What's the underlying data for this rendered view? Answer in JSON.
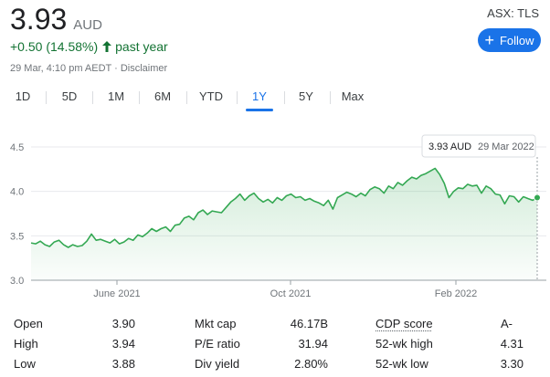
{
  "quote": {
    "price": "3.93",
    "currency": "AUD",
    "change": "+0.50 (14.58%)",
    "period": "past year",
    "timestamp": "29 Mar, 4:10 pm AEDT · Disclaimer",
    "ticker": "ASX: TLS",
    "follow_label": "Follow",
    "colors": {
      "positive": "#137333",
      "accent": "#1a73e8",
      "line": "#34a853"
    }
  },
  "range_tabs": [
    {
      "label": "1D",
      "active": false
    },
    {
      "label": "5D",
      "active": false
    },
    {
      "label": "1M",
      "active": false
    },
    {
      "label": "6M",
      "active": false
    },
    {
      "label": "YTD",
      "active": false
    },
    {
      "label": "1Y",
      "active": true
    },
    {
      "label": "5Y",
      "active": false
    },
    {
      "label": "Max",
      "active": false
    }
  ],
  "tooltip": {
    "price": "3.93 AUD",
    "date": "29 Mar 2022"
  },
  "chart_data": {
    "type": "area",
    "title": "",
    "xlabel": "",
    "ylabel": "",
    "ylim": [
      3.0,
      4.5
    ],
    "yticks": [
      "4.5",
      "4.0",
      "3.5",
      "3.0"
    ],
    "xticks": [
      "June 2021",
      "Oct 2021",
      "Feb 2022"
    ],
    "grid": true,
    "legend": "none",
    "series": [
      {
        "values": [
          3.42,
          3.41,
          3.44,
          3.4,
          3.38,
          3.43,
          3.45,
          3.4,
          3.37,
          3.4,
          3.38,
          3.39,
          3.44,
          3.52,
          3.45,
          3.46,
          3.44,
          3.42,
          3.46,
          3.41,
          3.43,
          3.47,
          3.45,
          3.51,
          3.49,
          3.53,
          3.58,
          3.55,
          3.58,
          3.6,
          3.55,
          3.62,
          3.63,
          3.7,
          3.72,
          3.68,
          3.76,
          3.79,
          3.74,
          3.78,
          3.77,
          3.76,
          3.82,
          3.88,
          3.92,
          3.97,
          3.9,
          3.95,
          3.98,
          3.92,
          3.88,
          3.91,
          3.87,
          3.93,
          3.9,
          3.95,
          3.97,
          3.93,
          3.94,
          3.9,
          3.92,
          3.89,
          3.87,
          3.84,
          3.9,
          3.8,
          3.93,
          3.96,
          3.99,
          3.97,
          3.94,
          3.98,
          3.95,
          4.02,
          4.05,
          4.03,
          3.98,
          4.06,
          4.03,
          4.1,
          4.07,
          4.12,
          4.16,
          4.14,
          4.18,
          4.2,
          4.23,
          4.26,
          4.19,
          4.09,
          3.93,
          4.0,
          4.04,
          4.03,
          4.08,
          4.06,
          4.07,
          3.98,
          4.06,
          4.03,
          3.97,
          3.96,
          3.86,
          3.95,
          3.94,
          3.88,
          3.94,
          3.92,
          3.9,
          3.93
        ]
      }
    ]
  },
  "stats": {
    "col1": [
      {
        "label": "Open",
        "value": "3.90"
      },
      {
        "label": "High",
        "value": "3.94"
      },
      {
        "label": "Low",
        "value": "3.88"
      }
    ],
    "col2": [
      {
        "label": "Mkt cap",
        "value": "46.17B"
      },
      {
        "label": "P/E ratio",
        "value": "31.94"
      },
      {
        "label": "Div yield",
        "value": "2.80%"
      }
    ],
    "col3": [
      {
        "label": "CDP score",
        "value": "A-"
      },
      {
        "label": "52-wk high",
        "value": "4.31"
      },
      {
        "label": "52-wk low",
        "value": "3.30"
      }
    ]
  }
}
